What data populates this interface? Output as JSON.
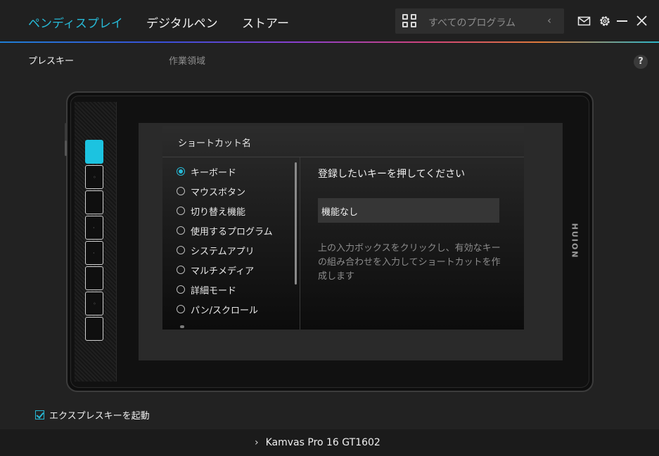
{
  "nav": {
    "tabs": [
      {
        "label": "ペンディスプレイ",
        "active": true
      },
      {
        "label": "デジタルペン",
        "active": false
      },
      {
        "label": "ストアー",
        "active": false
      }
    ]
  },
  "search": {
    "placeholder": "すべてのプログラム",
    "icon": "grid-icon",
    "collapse_icon": "chevron-left-icon"
  },
  "window_controls": {
    "icons": [
      "mail-icon",
      "gear-icon",
      "minimize-icon",
      "close-icon"
    ],
    "chevron": "‹"
  },
  "subtabs": [
    {
      "label": "プレスキー",
      "active": true
    },
    {
      "label": "作業領域",
      "active": false
    }
  ],
  "help": {
    "label": "?"
  },
  "tablet": {
    "brand": "HUION",
    "express_keys_count": 8,
    "active_key_index": 0
  },
  "dialog": {
    "title": "ショートカット名",
    "options": [
      {
        "label": "キーボード",
        "selected": true
      },
      {
        "label": "マウスボタン",
        "selected": false
      },
      {
        "label": "切り替え機能",
        "selected": false
      },
      {
        "label": "使用するプログラム",
        "selected": false
      },
      {
        "label": "システムアプリ",
        "selected": false
      },
      {
        "label": "マルチメディア",
        "selected": false
      },
      {
        "label": "詳細モード",
        "selected": false
      },
      {
        "label": "パン/スクロール",
        "selected": false
      }
    ],
    "prompt": "登録したいキーを押してください",
    "key_value": "機能なし",
    "hint": "上の入力ボックスをクリックし、有効なキーの組み合わせを入力してショートカットを作成します"
  },
  "enable_express_keys": {
    "label": "エクスプレスキーを起動",
    "checked": true
  },
  "footer": {
    "device": "Kamvas Pro 16 GT1602",
    "chevron": "›"
  },
  "colors": {
    "accent": "#27b9d6",
    "active_key": "#1cc3e0",
    "background": "#222222"
  }
}
